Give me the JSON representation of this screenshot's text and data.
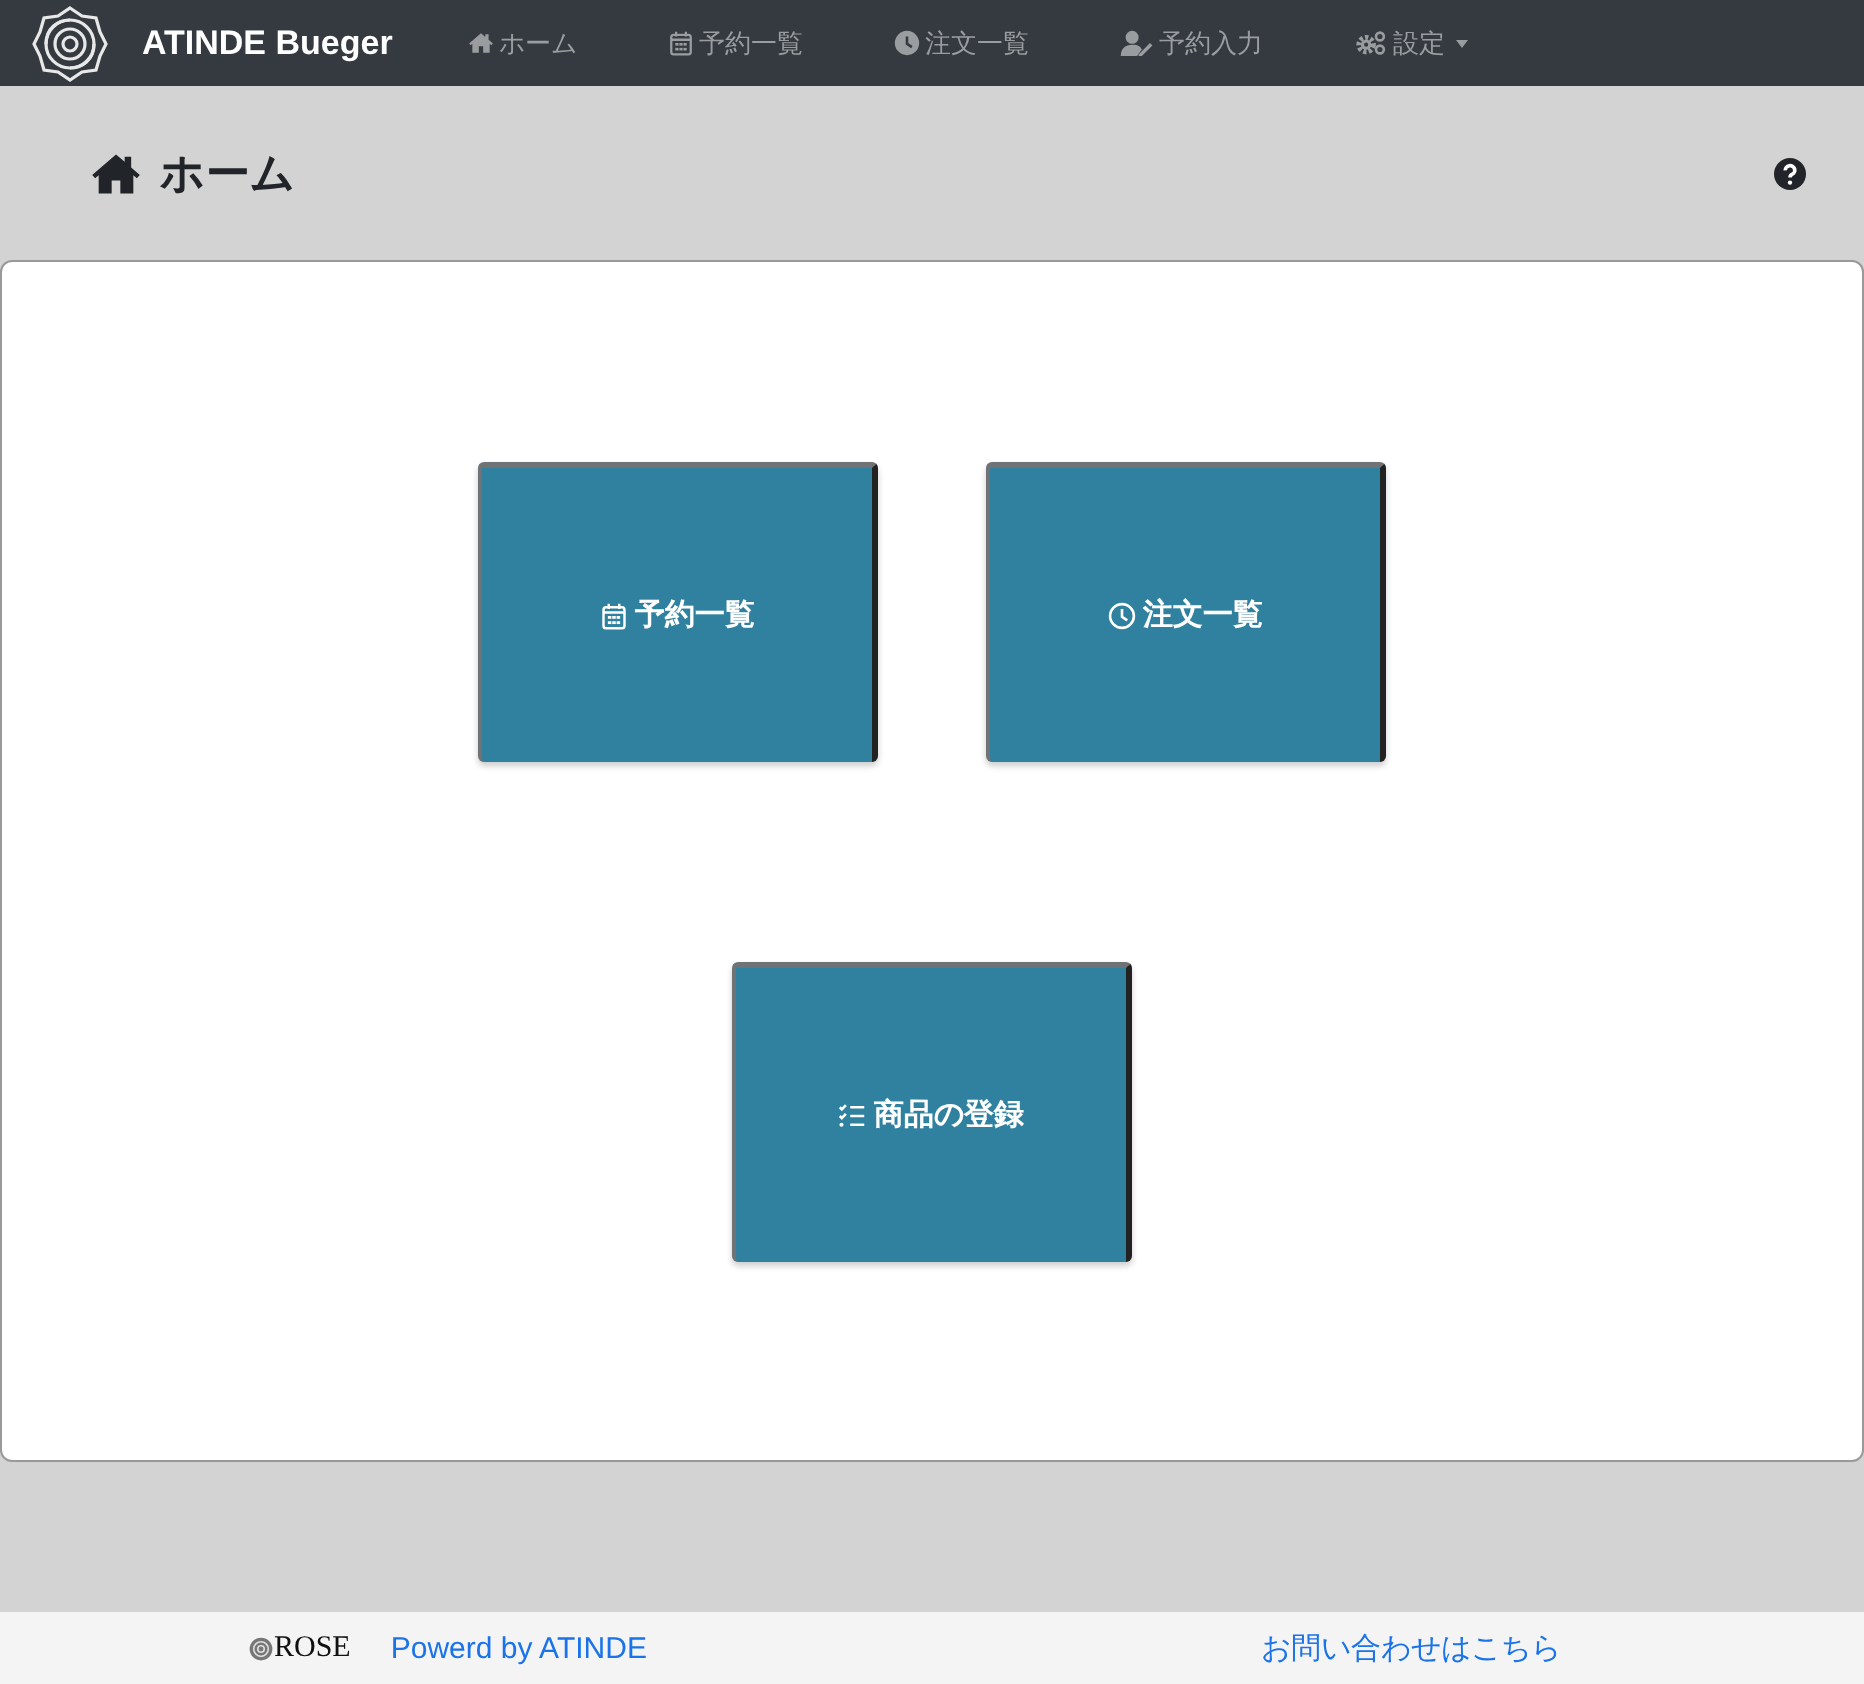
{
  "navbar": {
    "brand": "ATINDE Bueger",
    "items": [
      {
        "label": "ホーム",
        "dropdown": false
      },
      {
        "label": "予約一覧",
        "dropdown": false
      },
      {
        "label": "注文一覧",
        "dropdown": false
      },
      {
        "label": "予約入力",
        "dropdown": false
      },
      {
        "label": "設定",
        "dropdown": true
      }
    ]
  },
  "page_header": {
    "title": "ホーム"
  },
  "tiles": [
    {
      "label": "予約一覧"
    },
    {
      "label": "注文一覧"
    },
    {
      "label": "商品の登録"
    }
  ],
  "footer": {
    "logo_text": "ROSE",
    "powered_by": "Powerd by ATINDE",
    "contact": "お問い合わせはこちら"
  }
}
